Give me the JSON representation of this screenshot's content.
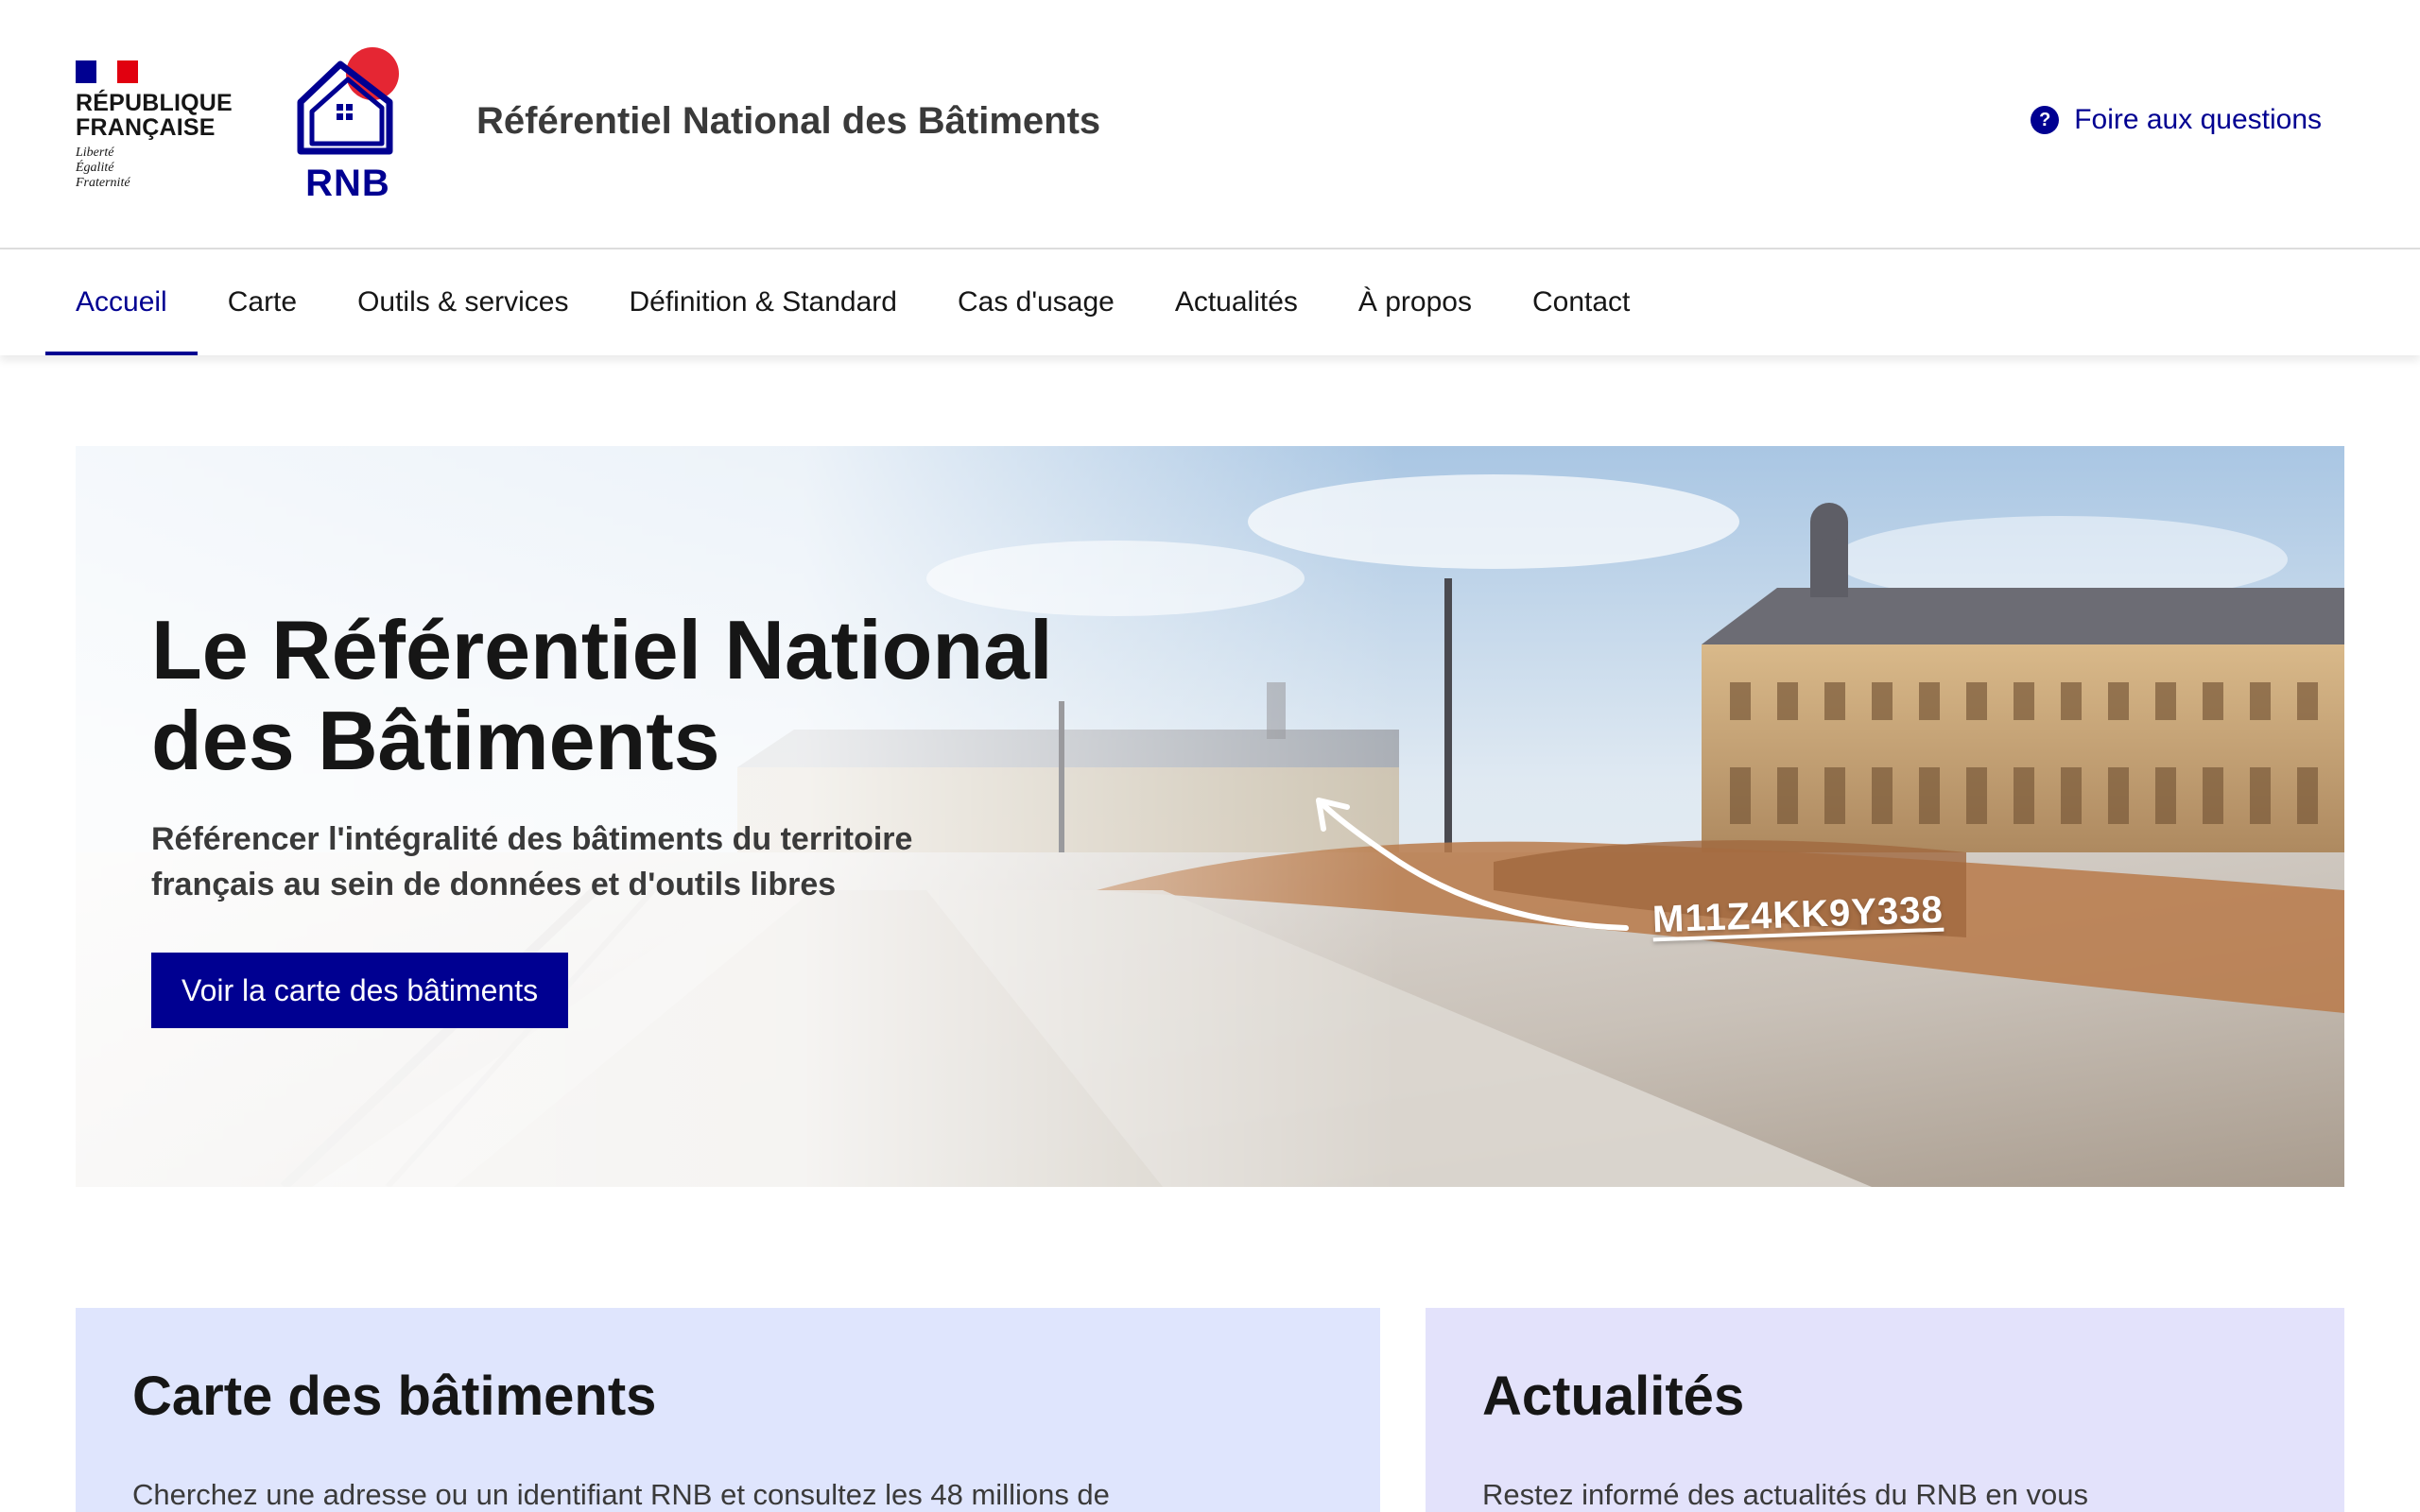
{
  "header": {
    "republique_name_line1": "RÉPUBLIQUE",
    "republique_name_line2": "FRANÇAISE",
    "motto": [
      "Liberté",
      "Égalité",
      "Fraternité"
    ],
    "rnb_logo_text": "RNB",
    "site_title": "Référentiel National des Bâtiments",
    "faq_label": "Foire aux questions",
    "faq_icon": "question-circle-icon"
  },
  "nav": {
    "items": [
      {
        "label": "Accueil",
        "active": true
      },
      {
        "label": "Carte"
      },
      {
        "label": "Outils & services"
      },
      {
        "label": "Définition & Standard"
      },
      {
        "label": "Cas d'usage"
      },
      {
        "label": "Actualités"
      },
      {
        "label": "À propos"
      },
      {
        "label": "Contact"
      }
    ]
  },
  "hero": {
    "title_line1": "Le Référentiel National",
    "title_line2": "des Bâtiments",
    "subtitle_line1": "Référencer l'intégralité des bâtiments du territoire",
    "subtitle_line2": "français au sein de données et d'outils libres",
    "cta_label": "Voir la carte des bâtiments",
    "building_id": "M11Z4KK9Y338"
  },
  "cards": {
    "map": {
      "title": "Carte des bâtiments",
      "text": "Cherchez une adresse ou un identifiant RNB et consultez les 48 millions de"
    },
    "news": {
      "title": "Actualités",
      "text": "Restez informé des actualités du RNB en vous"
    }
  },
  "colors": {
    "primary": "#000091",
    "marianne_red": "#e1000f",
    "card_blue": "#dfe5fd",
    "card_purple": "#e3e2fb"
  }
}
